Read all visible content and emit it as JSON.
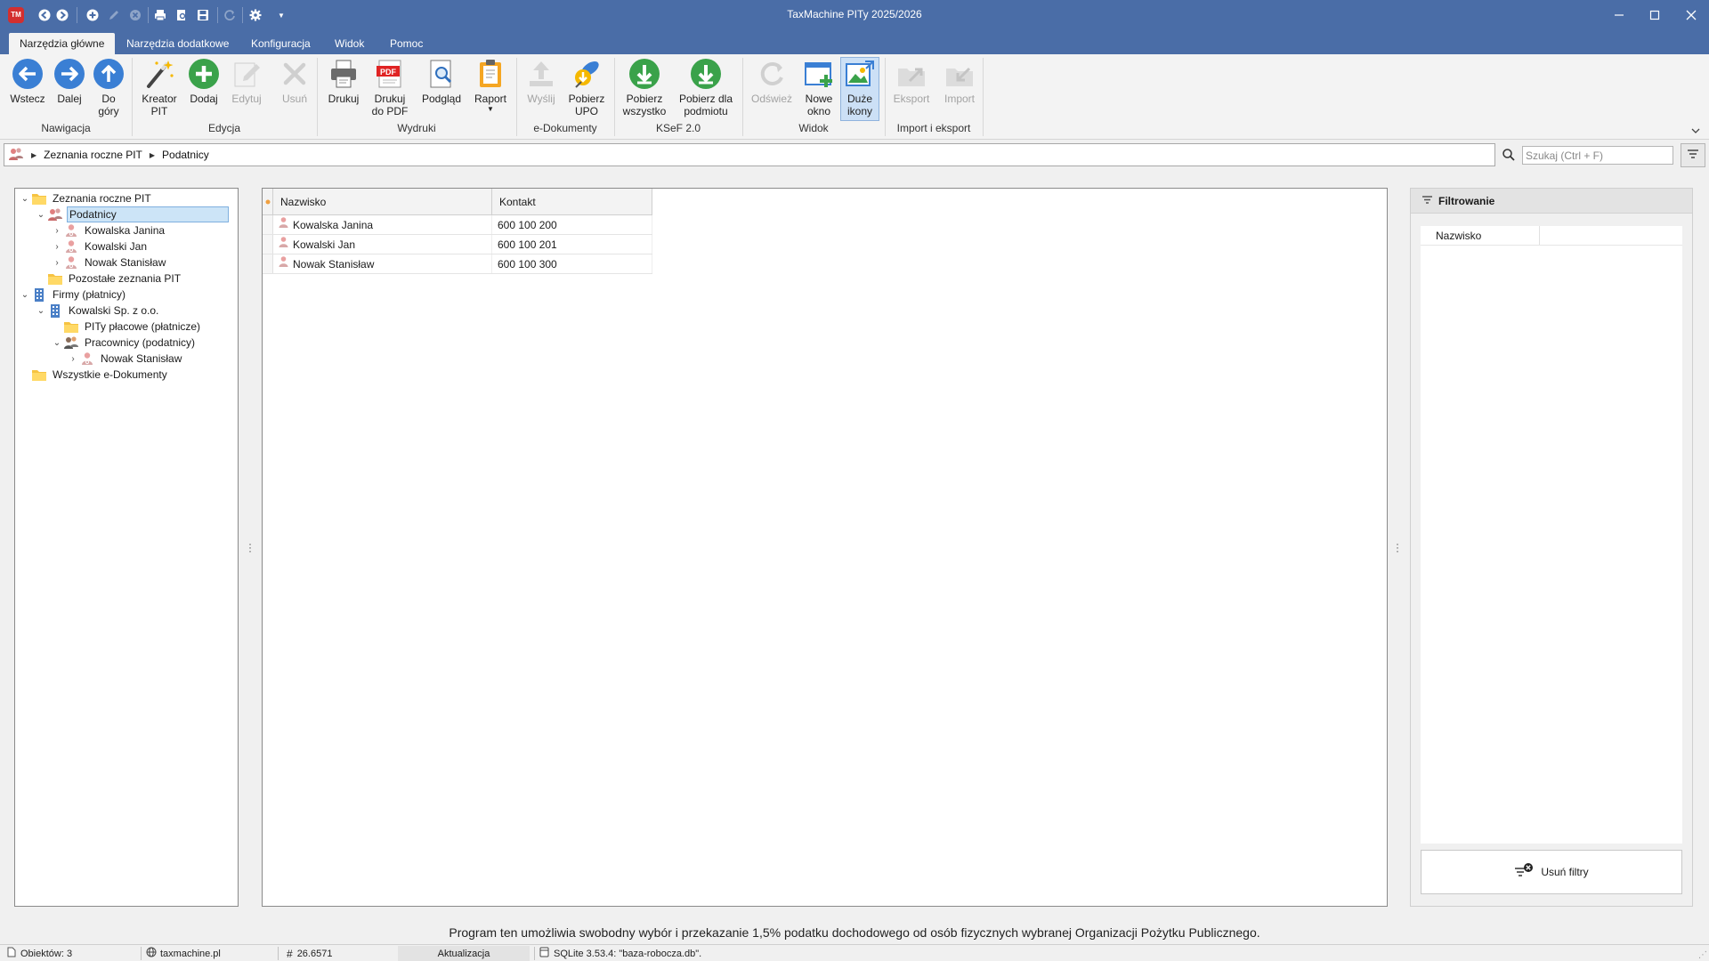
{
  "window": {
    "title": "TaxMachine PITy 2025/2026",
    "logo": "TM"
  },
  "quick_access": [
    "back-icon",
    "forward-icon",
    "add-icon",
    "edit-icon",
    "delete-icon",
    "print-icon",
    "print-preview-icon",
    "save-icon",
    "refresh-icon",
    "settings-icon",
    "dropdown-icon"
  ],
  "tabs": [
    "Narzędzia główne",
    "Narzędzia dodatkowe",
    "Konfiguracja",
    "Widok",
    "Pomoc"
  ],
  "ribbon": {
    "groups": [
      "Nawigacja",
      "Edycja",
      "Wydruki",
      "e-Dokumenty",
      "KSeF 2.0",
      "Widok",
      "Import i eksport"
    ],
    "buttons": {
      "back": "Wstecz",
      "forward": "Dalej",
      "up_line1": "Do",
      "up_line2": "góry",
      "wizard_line1": "Kreator",
      "wizard_line2": "PIT",
      "add": "Dodaj",
      "edit": "Edytuj",
      "delete": "Usuń",
      "print": "Drukuj",
      "print_pdf_line1": "Drukuj",
      "print_pdf_line2": "do PDF",
      "preview": "Podgląd",
      "report": "Raport",
      "send": "Wyślij",
      "upo_line1": "Pobierz",
      "upo_line2": "UPO",
      "download_all_line1": "Pobierz",
      "download_all_line2": "wszystko",
      "download_entity_line1": "Pobierz dla",
      "download_entity_line2": "podmiotu",
      "refresh": "Odśwież",
      "new_window_line1": "Nowe",
      "new_window_line2": "okno",
      "large_icons_line1": "Duże",
      "large_icons_line2": "ikony",
      "export": "Eksport",
      "import": "Import"
    },
    "pdf_badge": "PDF"
  },
  "breadcrumb": [
    "Zeznania roczne PIT",
    "Podatnicy"
  ],
  "search": {
    "placeholder": "Szukaj (Ctrl + F)"
  },
  "tree": [
    "Zeznania roczne PIT",
    "Podatnicy",
    "Kowalska Janina",
    "Kowalski Jan",
    "Nowak Stanisław",
    "Pozostałe zeznania PIT",
    "Firmy (płatnicy)",
    "Kowalski Sp. z o.o.",
    "PITy płacowe (płatnicze)",
    "Pracownicy (podatnicy)",
    "Nowak Stanisław",
    "Wszystkie e-Dokumenty"
  ],
  "grid": {
    "columns": [
      "Nazwisko",
      "Kontakt"
    ],
    "rows": [
      [
        "Kowalska Janina",
        "600 100 200"
      ],
      [
        "Kowalski Jan",
        "600 100 201"
      ],
      [
        "Nowak Stanisław",
        "600 100 300"
      ]
    ]
  },
  "filter_panel": {
    "title": "Filtrowanie",
    "field": "Nazwisko",
    "clear_button": "Usuń filtry"
  },
  "info_text": "Program ten umożliwia swobodny wybór i przekazanie 1,5% podatku dochodowego od osób fizycznych wybranej Organizacji Pożytku Publicznego.",
  "statusbar": {
    "objects": "Obiektów: 3",
    "website": "taxmachine.pl",
    "version": "26.6571",
    "update": "Aktualizacja",
    "database": "SQLite 3.53.4: \"baza-robocza.db\"."
  },
  "colors": {
    "titlebar": "#4a6da7",
    "accent_green": "#3aa24a",
    "accent_blue": "#3a7fd4",
    "selection": "#cce4f7"
  }
}
